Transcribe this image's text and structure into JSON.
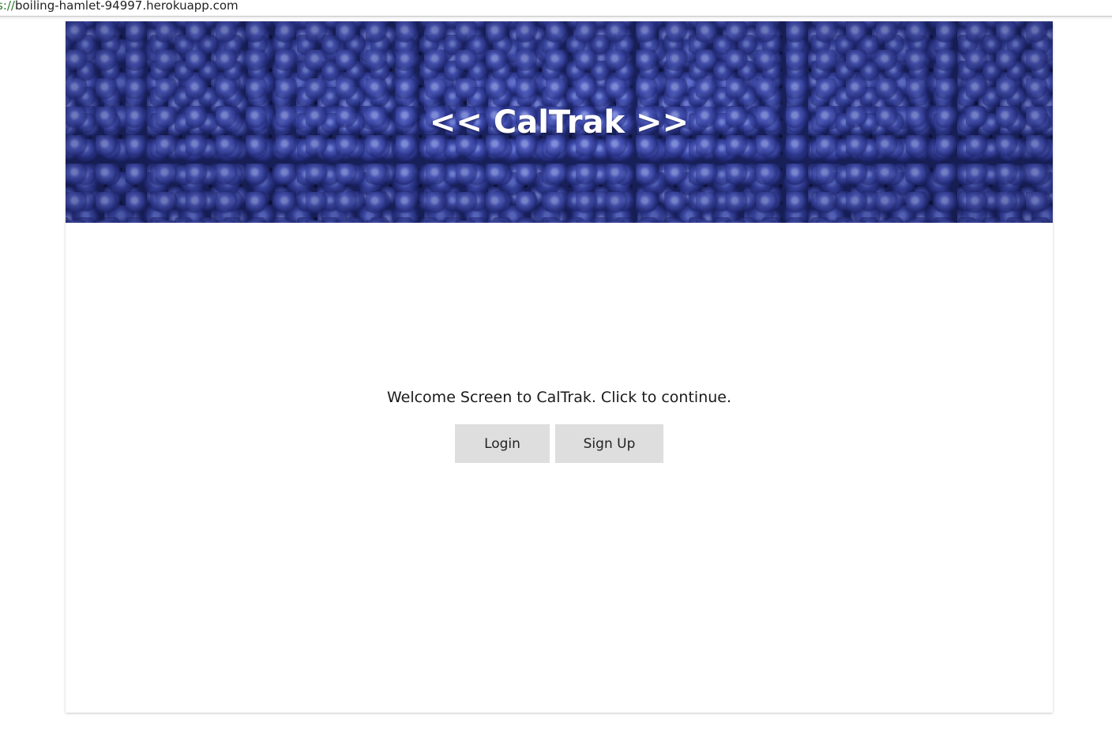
{
  "browser": {
    "url_scheme": "s://",
    "url_host": "boiling-hamlet-94997.herokuapp.com"
  },
  "banner": {
    "title": "<< CalTrak >>"
  },
  "main": {
    "welcome_text": "Welcome Screen to CalTrak. Click to continue.",
    "login_label": "Login",
    "signup_label": "Sign Up"
  },
  "colors": {
    "banner_base": "#1b2460",
    "button_bg": "#dedede",
    "text": "#1a1a1a"
  }
}
